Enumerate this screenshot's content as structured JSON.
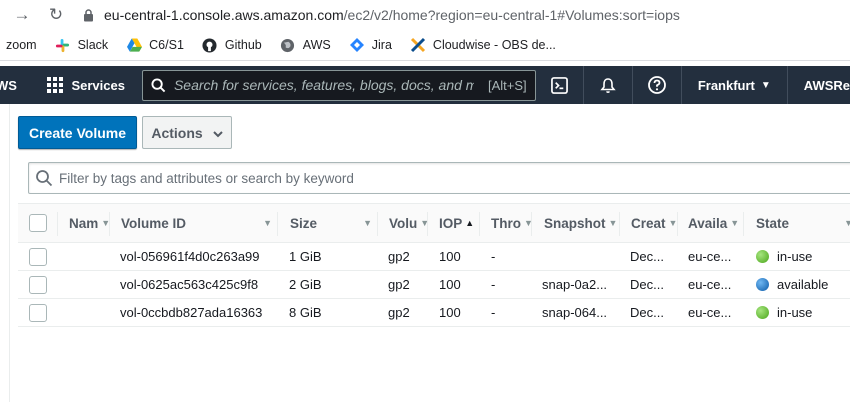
{
  "browser": {
    "url_host": "eu-central-1.console.aws.amazon.com",
    "url_rest": "/ec2/v2/home?region=eu-central-1#Volumes:sort=iops"
  },
  "bookmarks": [
    {
      "label": "zoom",
      "icon": "none"
    },
    {
      "label": "Slack",
      "icon": "slack-icon"
    },
    {
      "label": "C6/S1",
      "icon": "google-drive-icon"
    },
    {
      "label": "Github",
      "icon": "github-icon"
    },
    {
      "label": "AWS",
      "icon": "globe-icon"
    },
    {
      "label": "Jira",
      "icon": "jira-icon"
    },
    {
      "label": "Cloudwise - OBS de...",
      "icon": "cloudwise-icon"
    }
  ],
  "awsnav": {
    "logo_text": "WS",
    "services_label": "Services",
    "search_placeholder": "Search for services, features, blogs, docs, and mo",
    "search_shortcut": "[Alt+S]",
    "region": "Frankfurt",
    "account": "AWSRe"
  },
  "toolbar": {
    "create_label": "Create Volume",
    "actions_label": "Actions"
  },
  "filter": {
    "placeholder": "Filter by tags and attributes or search by keyword"
  },
  "table": {
    "columns": [
      "Nam",
      "Volume ID",
      "Size",
      "Volu",
      "IOP",
      "Thro",
      "Snapshot",
      "Creat",
      "Availa",
      "State"
    ],
    "rows": [
      {
        "name": "",
        "volume_id": "vol-056961f4d0c263a99",
        "size": "1 GiB",
        "type": "gp2",
        "iops": "100",
        "throughput": "-",
        "snapshot": "",
        "created": "Dec...",
        "az": "eu-ce...",
        "state": "in-use",
        "state_color": "#58c22e"
      },
      {
        "name": "",
        "volume_id": "vol-0625ac563c425c9f8",
        "size": "2 GiB",
        "type": "gp2",
        "iops": "100",
        "throughput": "-",
        "snapshot": "snap-0a2...",
        "created": "Dec...",
        "az": "eu-ce...",
        "state": "available",
        "state_color": "#1166bb"
      },
      {
        "name": "",
        "volume_id": "vol-0ccbdb827ada16363",
        "size": "8 GiB",
        "type": "gp2",
        "iops": "100",
        "throughput": "-",
        "snapshot": "snap-064...",
        "created": "Dec...",
        "az": "eu-ce...",
        "state": "in-use",
        "state_color": "#58c22e"
      }
    ]
  },
  "colors": {
    "nav_bg": "#232f3e",
    "primary": "#0073bb",
    "in_use": "#58c22e",
    "available": "#1166bb"
  }
}
